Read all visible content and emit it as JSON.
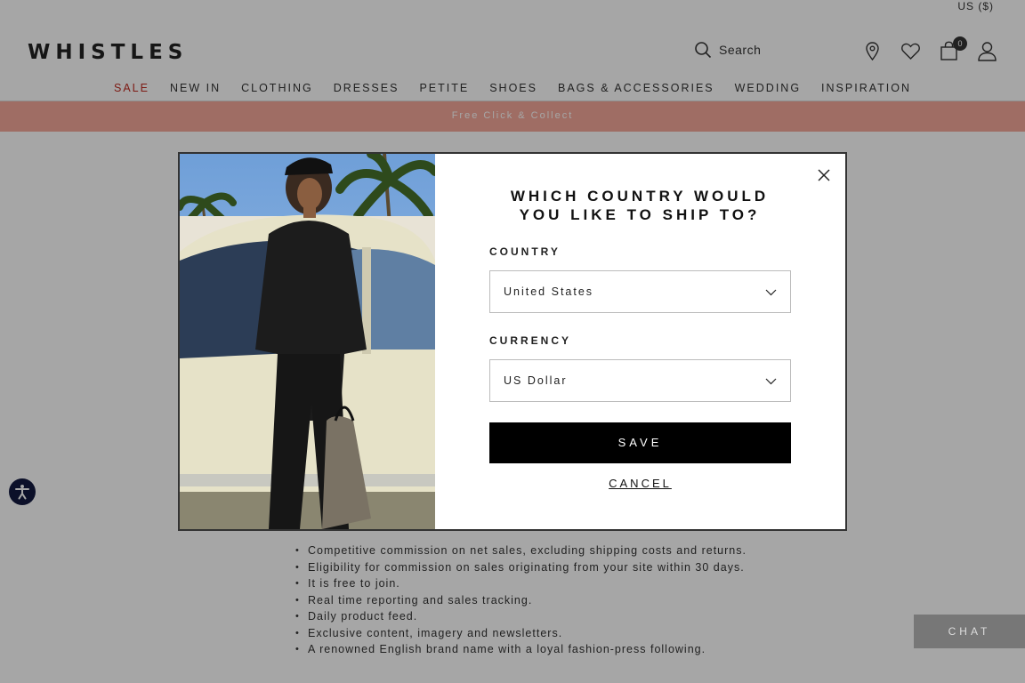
{
  "header": {
    "currency_link": "US ($)",
    "logo": "WHISTLES",
    "search_placeholder": "Search",
    "bag_count": "0"
  },
  "nav": {
    "items": [
      "SALE",
      "NEW IN",
      "CLOTHING",
      "DRESSES",
      "PETITE",
      "SHOES",
      "BAGS & ACCESSORIES",
      "WEDDING",
      "INSPIRATION"
    ]
  },
  "promo": {
    "text": "Free Click & Collect"
  },
  "content": {
    "bullets": [
      "Competitive commission on net sales, excluding shipping costs and returns.",
      "Eligibility for commission on sales originating from your site within 30 days.",
      "It is free to join.",
      "Real time reporting and sales tracking.",
      "Daily product feed.",
      "Exclusive content, imagery and newsletters.",
      "A renowned English brand name with a loyal fashion-press following."
    ]
  },
  "chat": {
    "label": "CHAT"
  },
  "modal": {
    "title": "WHICH COUNTRY WOULD YOU LIKE TO SHIP TO?",
    "country_label": "COUNTRY",
    "country_value": "United States",
    "currency_label": "CURRENCY",
    "currency_value": "US Dollar",
    "save_label": "SAVE",
    "cancel_label": "CANCEL"
  },
  "colors": {
    "sale": "#c02a20",
    "promo_bar": "#f4a89a",
    "save_button": "#000000",
    "accessibility_button": "#131a40"
  }
}
